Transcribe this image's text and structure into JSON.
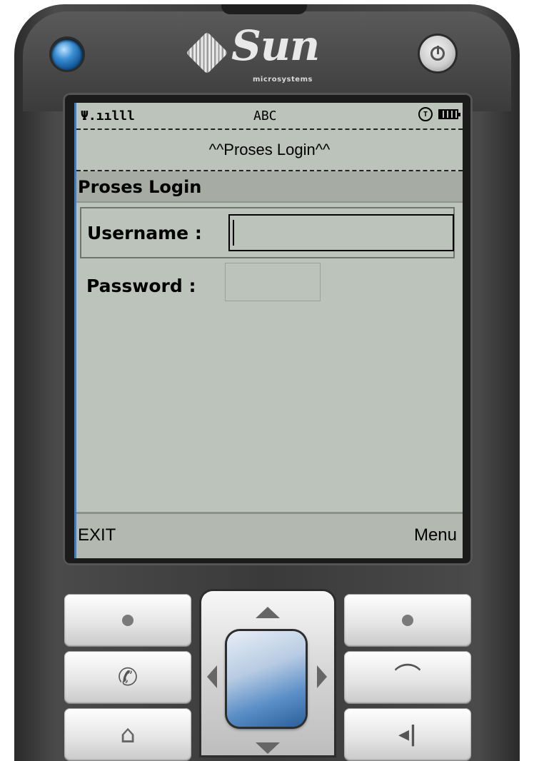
{
  "device": {
    "brand": "Sun",
    "brand_sub": "microsystems"
  },
  "status_bar": {
    "signal": "Ψ.ıılll",
    "input_mode": "ABC",
    "icons": [
      "signal-icon",
      "clock-icon",
      "battery-icon"
    ]
  },
  "ticker": "^^Proses Login^^",
  "form": {
    "title": "Proses Login",
    "username_label": "Username :",
    "username_value": "",
    "password_label": "Password :",
    "password_value": ""
  },
  "softkeys": {
    "left": "EXIT",
    "right": "Menu"
  },
  "colors": {
    "screen_bg": "#bcc3ba",
    "title_bg": "#a6aca4",
    "accent": "#3a7fc4"
  }
}
